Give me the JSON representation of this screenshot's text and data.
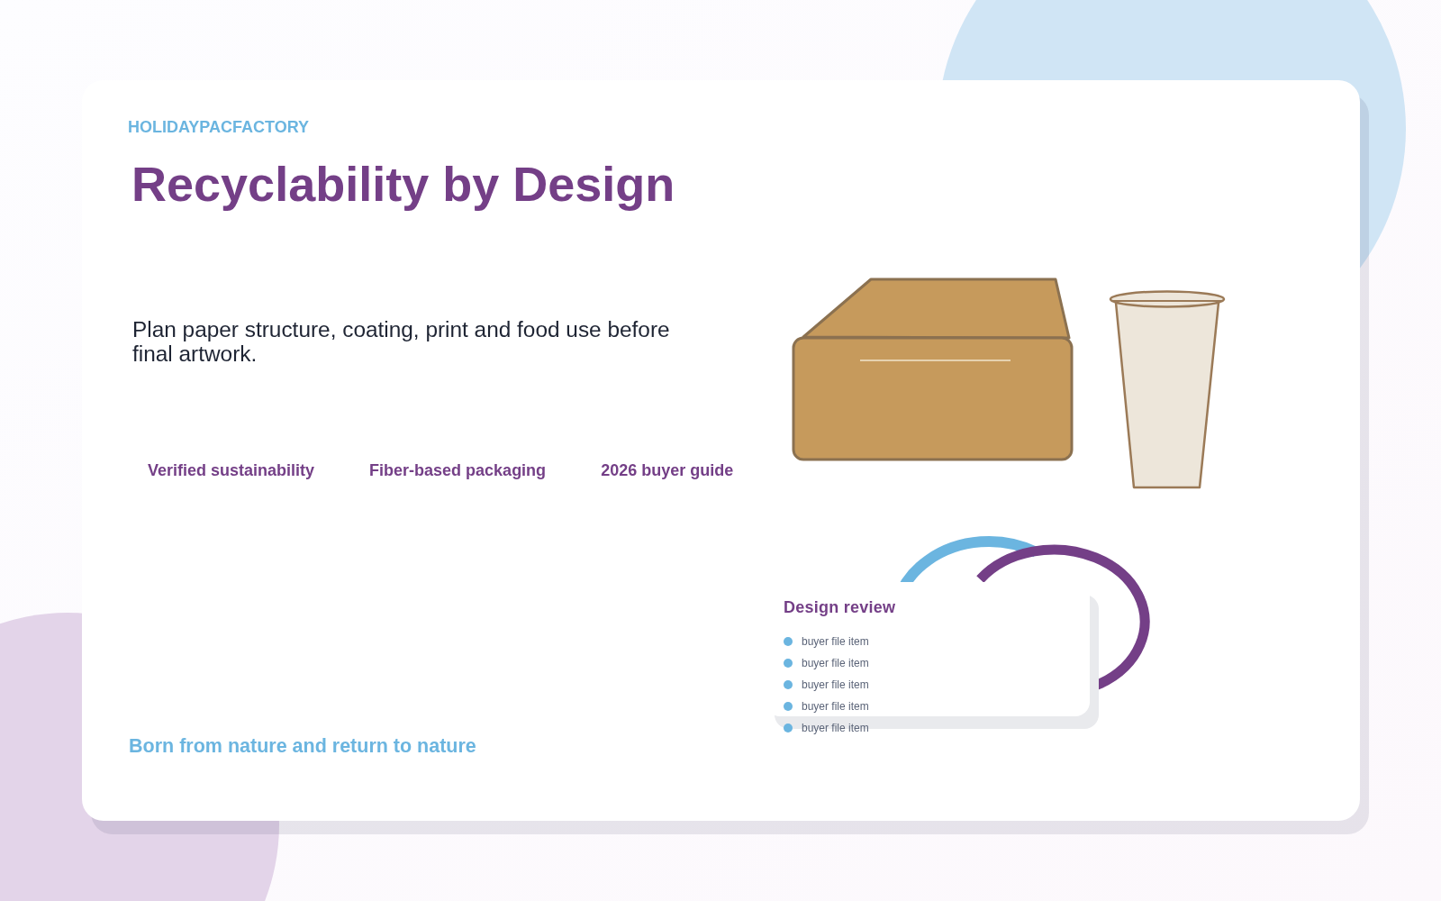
{
  "brand": "HOLIDAYPACFACTORY",
  "title": "Recyclability by Design",
  "intro": "Plan paper structure, coating, print and food use before final artwork.",
  "tags": [
    "Verified sustainability",
    "Fiber-based packaging",
    "2026 buyer guide"
  ],
  "tagline": "Born from nature and return to nature",
  "review_card": {
    "title": "Design review",
    "items": [
      "buyer file item",
      "buyer file item",
      "buyer file item",
      "buyer file item",
      "buyer file item"
    ]
  }
}
